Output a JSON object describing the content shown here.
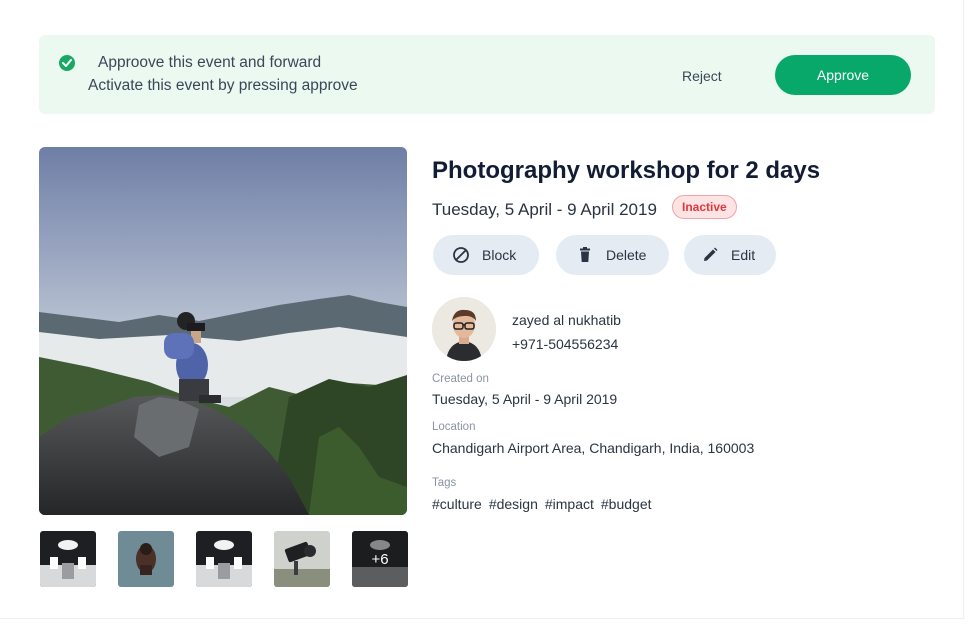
{
  "banner": {
    "title": "Approove this event and forward",
    "subtitle": "Activate this event by pressing approve",
    "reject_label": "Reject",
    "approve_label": "Approve",
    "check_icon": "check-circle-icon",
    "accent_color": "#08a86b"
  },
  "event": {
    "title": "Photography workshop for 2 days",
    "date": "Tuesday, 5 April - 9 April 2019",
    "status": "Inactive",
    "actions": {
      "block_label": "Block",
      "delete_label": "Delete",
      "edit_label": "Edit"
    },
    "organizer": {
      "name": "zayed al nukhatib",
      "phone": "+971-504556234"
    },
    "created_on": {
      "label": "Created on",
      "value": "Tuesday, 5 April - 9 April 2019"
    },
    "location": {
      "label": "Location",
      "value": "Chandigarh Airport Area, Chandigarh, India, 160003"
    },
    "tags": {
      "label": "Tags",
      "items": [
        "#culture",
        "#design",
        "#impact",
        "#budget"
      ]
    }
  },
  "gallery": {
    "more_label": "+6"
  }
}
